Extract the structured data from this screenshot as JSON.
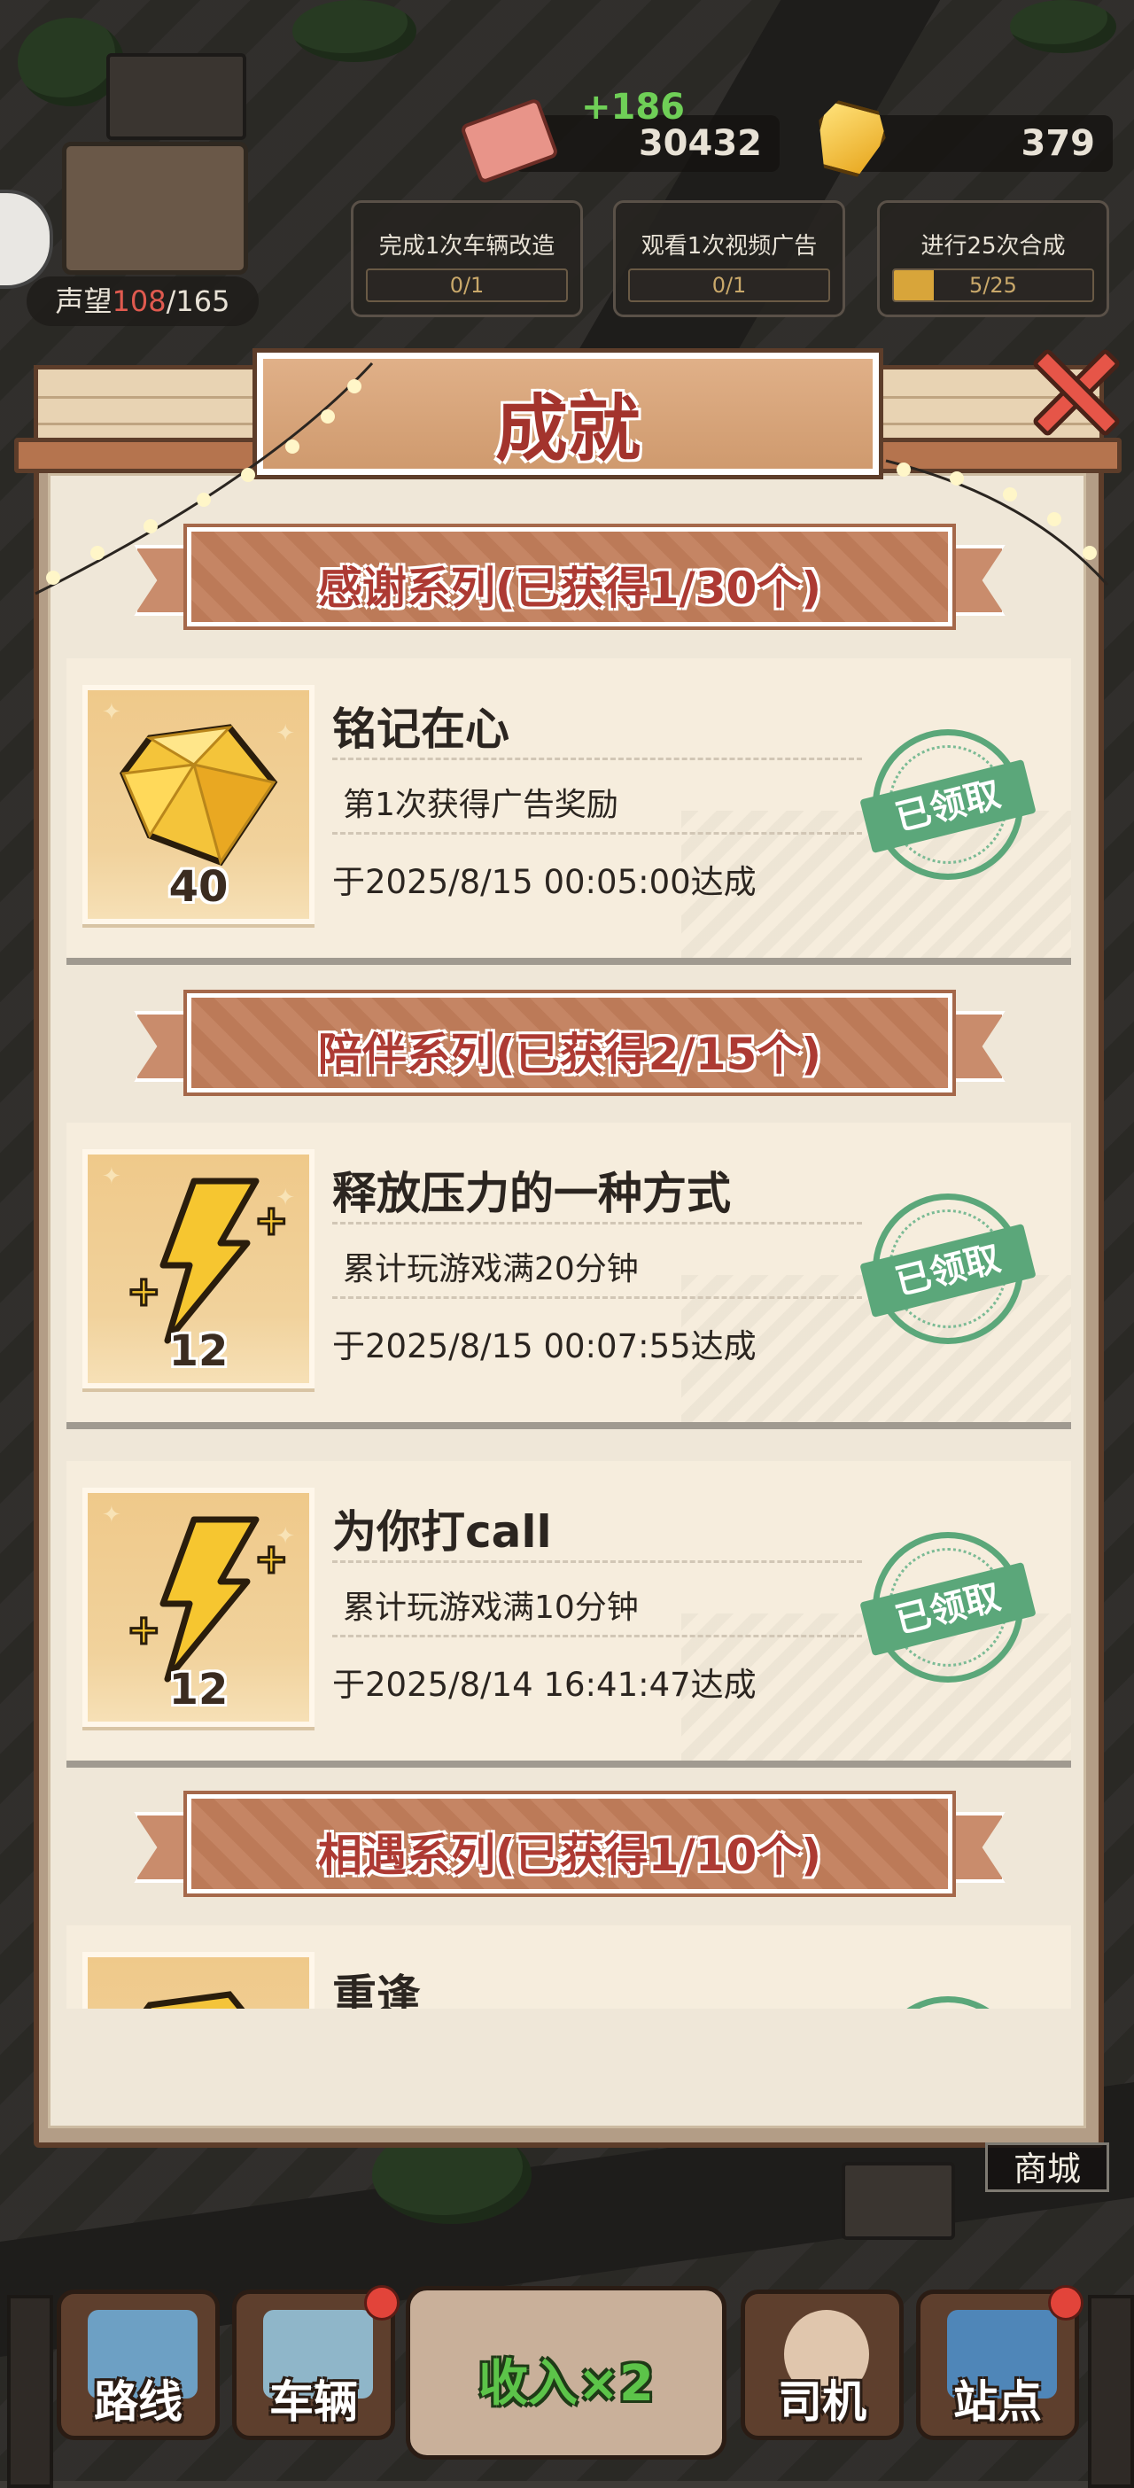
{
  "hud": {
    "money_gain": "+186",
    "money": "30432",
    "gems": "379",
    "reputation_label": "声望",
    "reputation_current": "108",
    "reputation_max": "/165"
  },
  "tasks": [
    {
      "text": "完成1次车辆改造",
      "progress_text": "0/1",
      "progress": 0.0
    },
    {
      "text": "观看1次视频广告",
      "progress_text": "0/1",
      "progress": 0.0
    },
    {
      "text": "进行25次合成",
      "progress_text": "5/25",
      "progress": 0.2
    }
  ],
  "panel": {
    "title": "成就",
    "sections": [
      {
        "title": "感谢系列(已获得1/30个)",
        "items": [
          {
            "name": "铭记在心",
            "desc": "第1次获得广告奖励",
            "date": "于2025/8/15 00:05:00达成",
            "reward_icon": "diamond-icon",
            "reward_qty": "40",
            "status": "已领取"
          }
        ]
      },
      {
        "title": "陪伴系列(已获得2/15个)",
        "items": [
          {
            "name": "释放压力的一种方式",
            "desc": "累计玩游戏满20分钟",
            "date": "于2025/8/15 00:07:55达成",
            "reward_icon": "lightning-icon",
            "reward_qty": "12",
            "status": "已领取"
          },
          {
            "name": "为你打call",
            "desc": "累计玩游戏满10分钟",
            "date": "于2025/8/14 16:41:47达成",
            "reward_icon": "lightning-icon",
            "reward_qty": "12",
            "status": "已领取"
          }
        ]
      },
      {
        "title": "相遇系列(已获得1/10个)",
        "items": [
          {
            "name": "重逢",
            "reward_icon": "diamond-icon"
          }
        ]
      }
    ]
  },
  "nav": {
    "shop": "商城",
    "route": "路线",
    "vehicle": "车辆",
    "income": "收入×2",
    "driver": "司机",
    "station": "站点"
  },
  "colors": {
    "title_red": "#a3342d",
    "stamp_green": "#5ba77a",
    "income_green": "#5cc449"
  }
}
